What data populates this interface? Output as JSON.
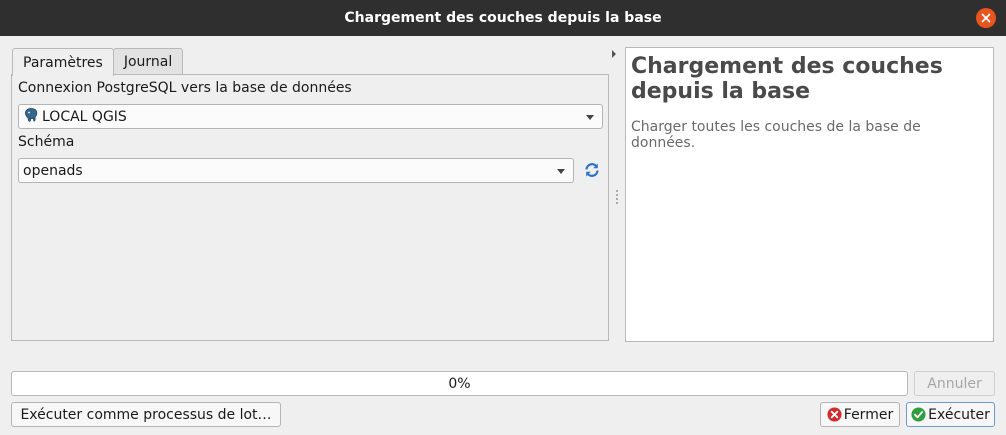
{
  "window": {
    "title": "Chargement des couches depuis la base",
    "close_icon": "close-icon"
  },
  "tabs": [
    {
      "label": "Paramètres",
      "active": true
    },
    {
      "label": "Journal",
      "active": false
    }
  ],
  "params": {
    "connection_label": "Connexion PostgreSQL vers la base de données",
    "connection_value": "LOCAL QGIS",
    "connection_icon": "postgresql-elephant-icon",
    "schema_label": "Schéma",
    "schema_value": "openads",
    "refresh_icon": "refresh-icon"
  },
  "help": {
    "title": "Chargement des couches depuis la base",
    "description": "Charger toutes les couches de la base de données."
  },
  "progress": {
    "value": 0,
    "text": "0%"
  },
  "buttons": {
    "cancel": "Annuler",
    "batch": "Exécuter comme processus de lot…",
    "close": "Fermer",
    "run": "Exécuter"
  },
  "colors": {
    "titlebar": "#2f2f2f",
    "close_button": "#e9541f",
    "run_icon": "#2e9e3f",
    "close_icon_red": "#d62a2a",
    "refresh_blue": "#2f74c4"
  }
}
